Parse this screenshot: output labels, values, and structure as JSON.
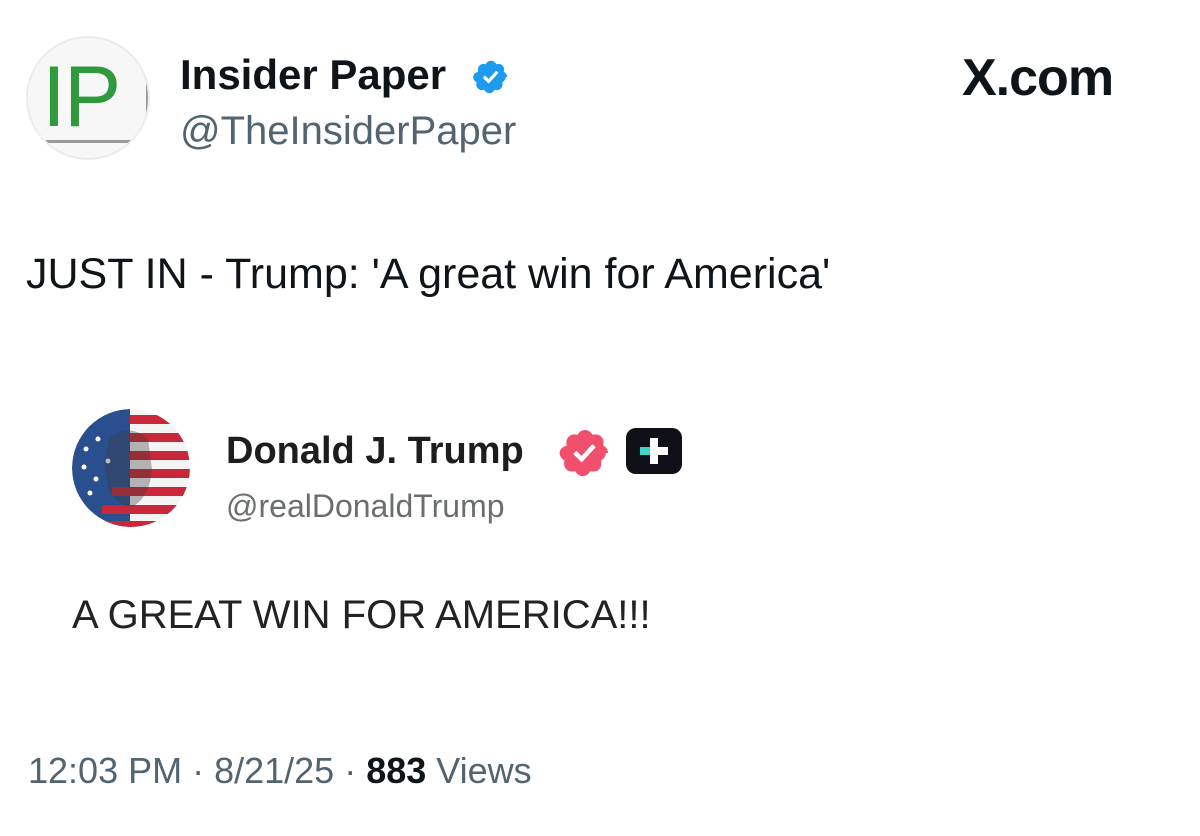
{
  "author": {
    "name": "Insider Paper",
    "handle": "@TheInsiderPaper",
    "avatar_logo_text": "IP",
    "verified_color": "#1d9bf0"
  },
  "brand": {
    "site_label": "X.com"
  },
  "tweet": {
    "text": "JUST IN - Trump: 'A great win for America'"
  },
  "embedded_post": {
    "name": "Donald J. Trump",
    "handle": "@realDonaldTrump",
    "text": "A GREAT WIN FOR AMERICA!!!",
    "verified_color": "#f0506e",
    "badge_icon": "truth-social-plus-icon"
  },
  "meta": {
    "time": "12:03 PM",
    "separator": " · ",
    "date": "8/21/25",
    "views_count": "883",
    "views_label": " Views"
  }
}
